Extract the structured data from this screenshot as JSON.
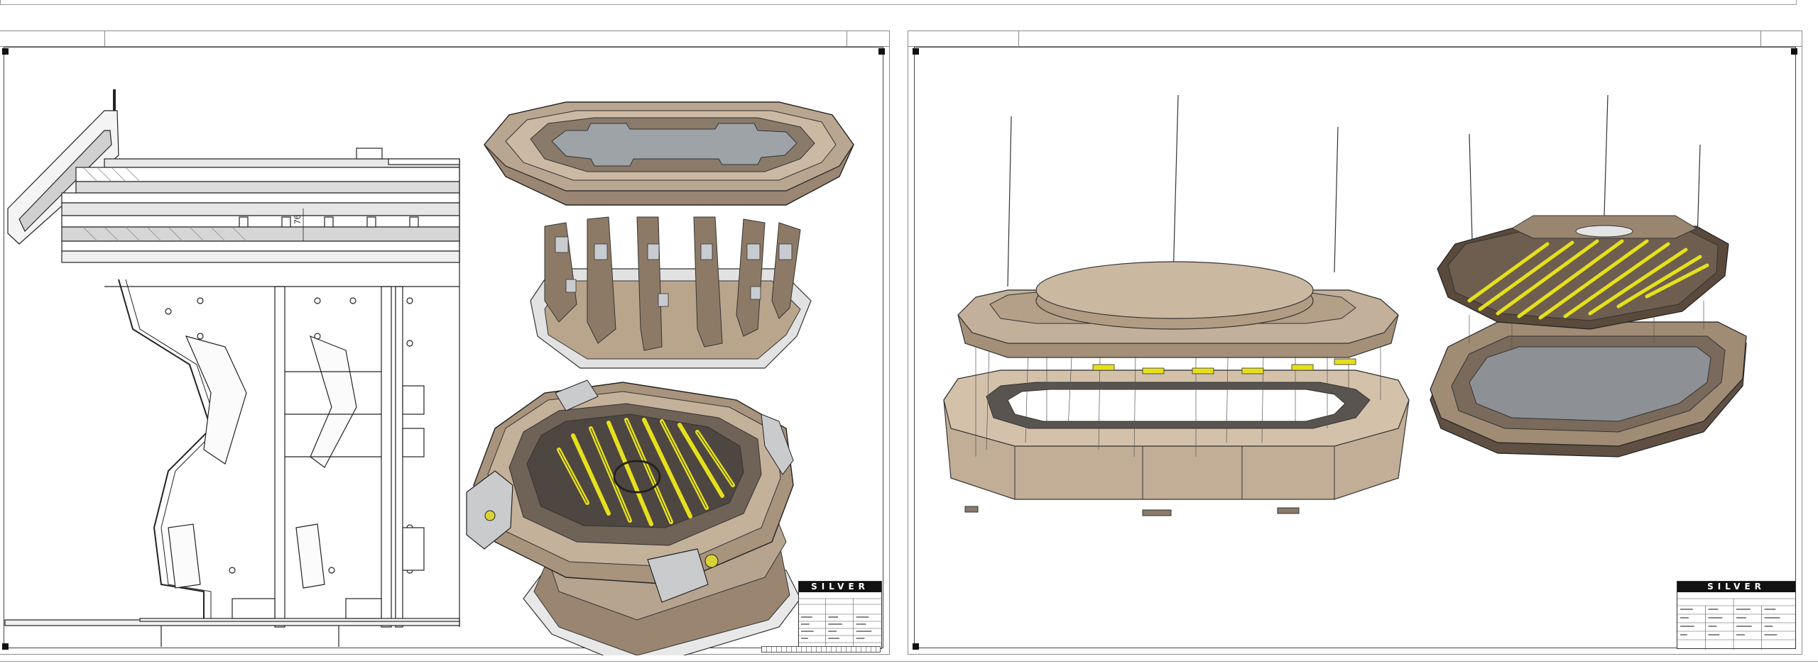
{
  "sheets": [
    {
      "id": "sheet-1",
      "views": [
        "section-view",
        "iso-view-assembled",
        "iso-view-open-top"
      ],
      "title_block": {
        "brand": "SILVER"
      }
    },
    {
      "id": "sheet-2",
      "views": [
        "exploded-view-top-assembly",
        "exploded-view-lid-and-tray"
      ],
      "title_block": {
        "brand": "SILVER"
      }
    }
  ],
  "section_view": {
    "dimension_label": "76"
  },
  "colors": {
    "frame": "#444444",
    "part_tan": "#b6a48e",
    "part_dark": "#5f5043",
    "glass": "#9aa0a6",
    "rails": "#e6e01c",
    "steel": "#c9cbcd"
  }
}
